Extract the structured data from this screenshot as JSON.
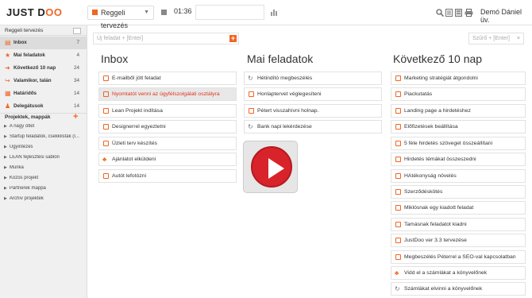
{
  "topbar": {
    "logo_a": "JUST D",
    "logo_b": "OO",
    "session": "Reggeli tervezés",
    "timer": "01:36",
    "user": "Demó Dániel üv."
  },
  "sidebar": {
    "header": "Reggeli tervezés",
    "items": [
      {
        "label": "Inbox",
        "count": "7",
        "icon": "inbox-icon"
      },
      {
        "label": "Mai feladatok",
        "count": "4",
        "icon": "star-icon"
      },
      {
        "label": "Következő 10 nap",
        "count": "24",
        "icon": "arrow-right-icon"
      },
      {
        "label": "Valamikor, talán",
        "count": "34",
        "icon": "arrow-forward-icon"
      },
      {
        "label": "Határidős",
        "count": "14",
        "icon": "calendar-icon"
      },
      {
        "label": "Delegátusok",
        "count": "14",
        "icon": "people-icon"
      }
    ],
    "projects_title": "Projektek, mappák",
    "projects": [
      "A nagy ötlet",
      "Startup feladatok, csekklisták (I...",
      "Ügyintézés",
      "LEAN fejlesztési sablon",
      "Munka",
      "Közös projekt",
      "Partnerek mappa",
      "Archív projektek"
    ]
  },
  "main": {
    "new_task_placeholder": "Új feladat + [Enter]",
    "filter_placeholder": "Szűrő + [Enter]",
    "columns": [
      {
        "title": "Inbox",
        "tasks": [
          "E-mailből jött feladat",
          "Nyomtatót venni az ügyfélszolgálati osztályra",
          "Lean Projekt indítása",
          "Designerrel egyeztetni",
          "Üzleti terv készítés",
          "Ajánlatot elküldeni",
          "Autót lefotózni"
        ]
      },
      {
        "title": "Mai feladatok",
        "tasks": [
          "Hétindító megbeszélés",
          "Honlaptervet véglegesíteni",
          "Pétert visszahívni holnap.",
          "Bank napi lekérdezése"
        ]
      },
      {
        "title": "Következő 10 nap",
        "tasks": [
          "Marketing stratégiát átgondolni",
          "Piackutatás",
          "Landing page a hirdetéshez",
          "Előfizetések beállítása",
          "5 féle hirdetés szöveget összeállítani",
          "Hirdetés témákat összeszedni",
          "HAtékonyság növelés",
          "Szerződéskötés",
          "Miklósnak egy kiadott feladat",
          "Tamásnak feladatot kiadni",
          "JustDoo ver 3.3 tervezése",
          "Megbeszélés Péterrel a SEO-val kapcsolatban",
          "Vidd el a számlákat a könyvelőnek",
          "Számlákat elvinni a könyvelőnek"
        ]
      }
    ]
  },
  "colors": {
    "accent": "#f26522",
    "highlight_text": "#e2331b",
    "play": "#d8232a"
  }
}
